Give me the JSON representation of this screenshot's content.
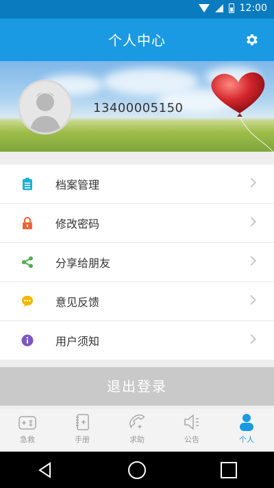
{
  "status_bar": {
    "time": "12:00"
  },
  "header": {
    "title": "个人中心",
    "settings_icon": "gear-icon"
  },
  "profile": {
    "phone": "13400005150",
    "avatar_icon": "avatar-placeholder"
  },
  "menu": {
    "items": [
      {
        "label": "档案管理",
        "icon": "clipboard-icon",
        "color": "#1ab2d6"
      },
      {
        "label": "修改密码",
        "icon": "lock-icon",
        "color": "#f0652f"
      },
      {
        "label": "分享给朋友",
        "icon": "share-icon",
        "color": "#4caf50"
      },
      {
        "label": "意见反馈",
        "icon": "chat-icon",
        "color": "#f5b500"
      },
      {
        "label": "用户须知",
        "icon": "info-icon",
        "color": "#7e57c2"
      }
    ]
  },
  "logout_label": "退出登录",
  "tabs": [
    {
      "label": "急救",
      "icon": "first-aid-icon",
      "active": false
    },
    {
      "label": "手册",
      "icon": "manual-icon",
      "active": false
    },
    {
      "label": "求助",
      "icon": "phone-icon",
      "active": false
    },
    {
      "label": "公告",
      "icon": "speaker-icon",
      "active": false
    },
    {
      "label": "个人",
      "icon": "person-icon",
      "active": true
    }
  ],
  "colors": {
    "accent": "#1a9ae3",
    "statusbar": "#0a7bbf"
  }
}
